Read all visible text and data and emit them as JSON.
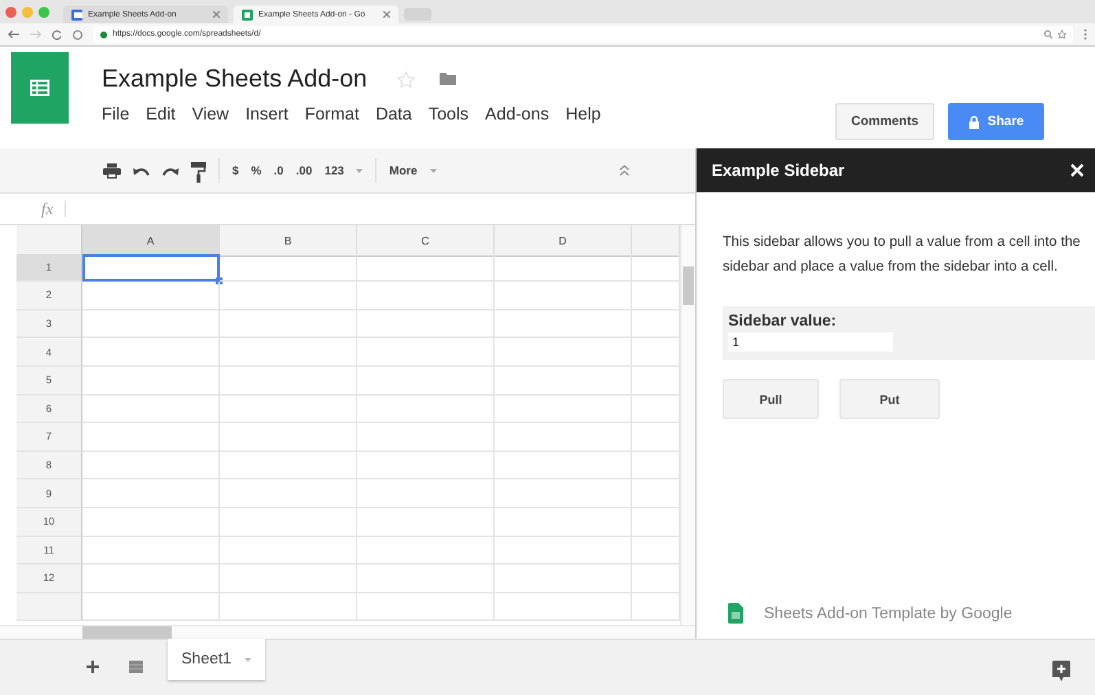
{
  "browser": {
    "tabs": [
      {
        "title": "Example Sheets Add-on",
        "selected": false
      },
      {
        "title": "Example Sheets Add-on - Go",
        "selected": true
      }
    ],
    "url": "https://docs.google.com/spreadsheets/d/"
  },
  "document": {
    "title": "Example Sheets Add-on"
  },
  "menu": [
    "File",
    "Edit",
    "View",
    "Insert",
    "Format",
    "Data",
    "Tools",
    "Add-ons",
    "Help"
  ],
  "header_buttons": {
    "comments": "Comments",
    "share": "Share"
  },
  "toolbar": {
    "format_items": [
      "$",
      "%",
      ".0",
      ".00",
      "123"
    ],
    "more": "More"
  },
  "formula_bar": {
    "label": "fx"
  },
  "grid": {
    "columns": [
      {
        "label": "A",
        "selected": true
      },
      {
        "label": "B",
        "selected": false
      },
      {
        "label": "C",
        "selected": false
      },
      {
        "label": "D",
        "selected": false
      }
    ],
    "rows": [
      {
        "label": "1",
        "selected": true
      },
      {
        "label": "2",
        "selected": false
      },
      {
        "label": "3",
        "selected": false
      },
      {
        "label": "4",
        "selected": false
      },
      {
        "label": "5",
        "selected": false
      },
      {
        "label": "6",
        "selected": false
      },
      {
        "label": "7",
        "selected": false
      },
      {
        "label": "8",
        "selected": false
      },
      {
        "label": "9",
        "selected": false
      },
      {
        "label": "10",
        "selected": false
      },
      {
        "label": "11",
        "selected": false
      },
      {
        "label": "12",
        "selected": false
      }
    ]
  },
  "sheet_tabs": [
    {
      "label": "Sheet1",
      "selected": true
    }
  ],
  "sidebar": {
    "title": "Example Sidebar",
    "description": "This sidebar allows you to pull a value from a cell into the sidebar and place a value from the sidebar into a cell.",
    "field": {
      "label": "Sidebar value:",
      "value": "1"
    },
    "buttons": [
      "Pull",
      "Put"
    ],
    "footer": "Sheets Add-on Template by Google"
  }
}
